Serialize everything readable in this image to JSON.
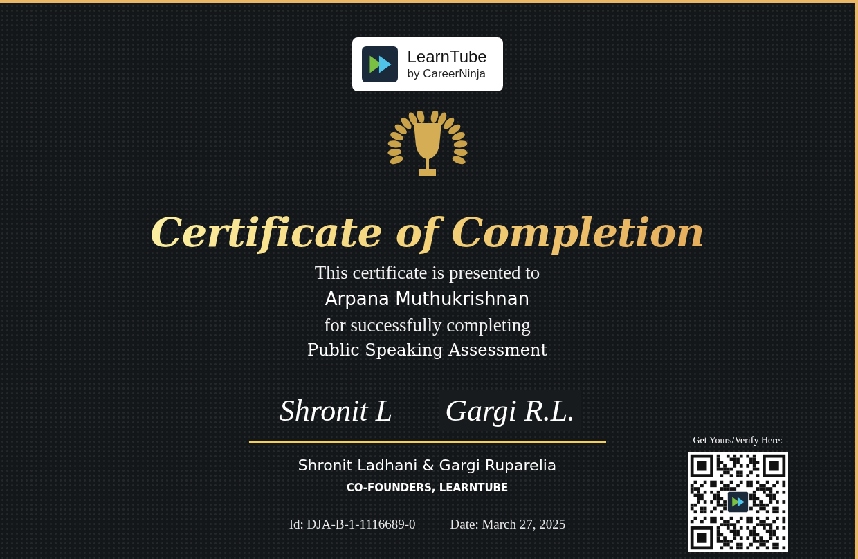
{
  "logo": {
    "name": "LearnTube",
    "tagline": "by CareerNinja"
  },
  "title": "Certificate of Completion",
  "presented_text": "This certificate is presented to",
  "recipient": "Arpana Muthukrishnan",
  "completion_text": "for successfully completing",
  "course": "Public Speaking Assessment",
  "signatures": [
    "Shronit L",
    "Gargi R.L."
  ],
  "signatories": "Shronit Ladhani & Gargi Ruparelia",
  "signatory_role": "CO-FOUNDERS, LEARNTUBE",
  "certificate_id": "Id: DJA-B-1-1116689-0",
  "date": "Date: March 27, 2025",
  "verify": {
    "label": "Get Yours/Verify Here:"
  }
}
